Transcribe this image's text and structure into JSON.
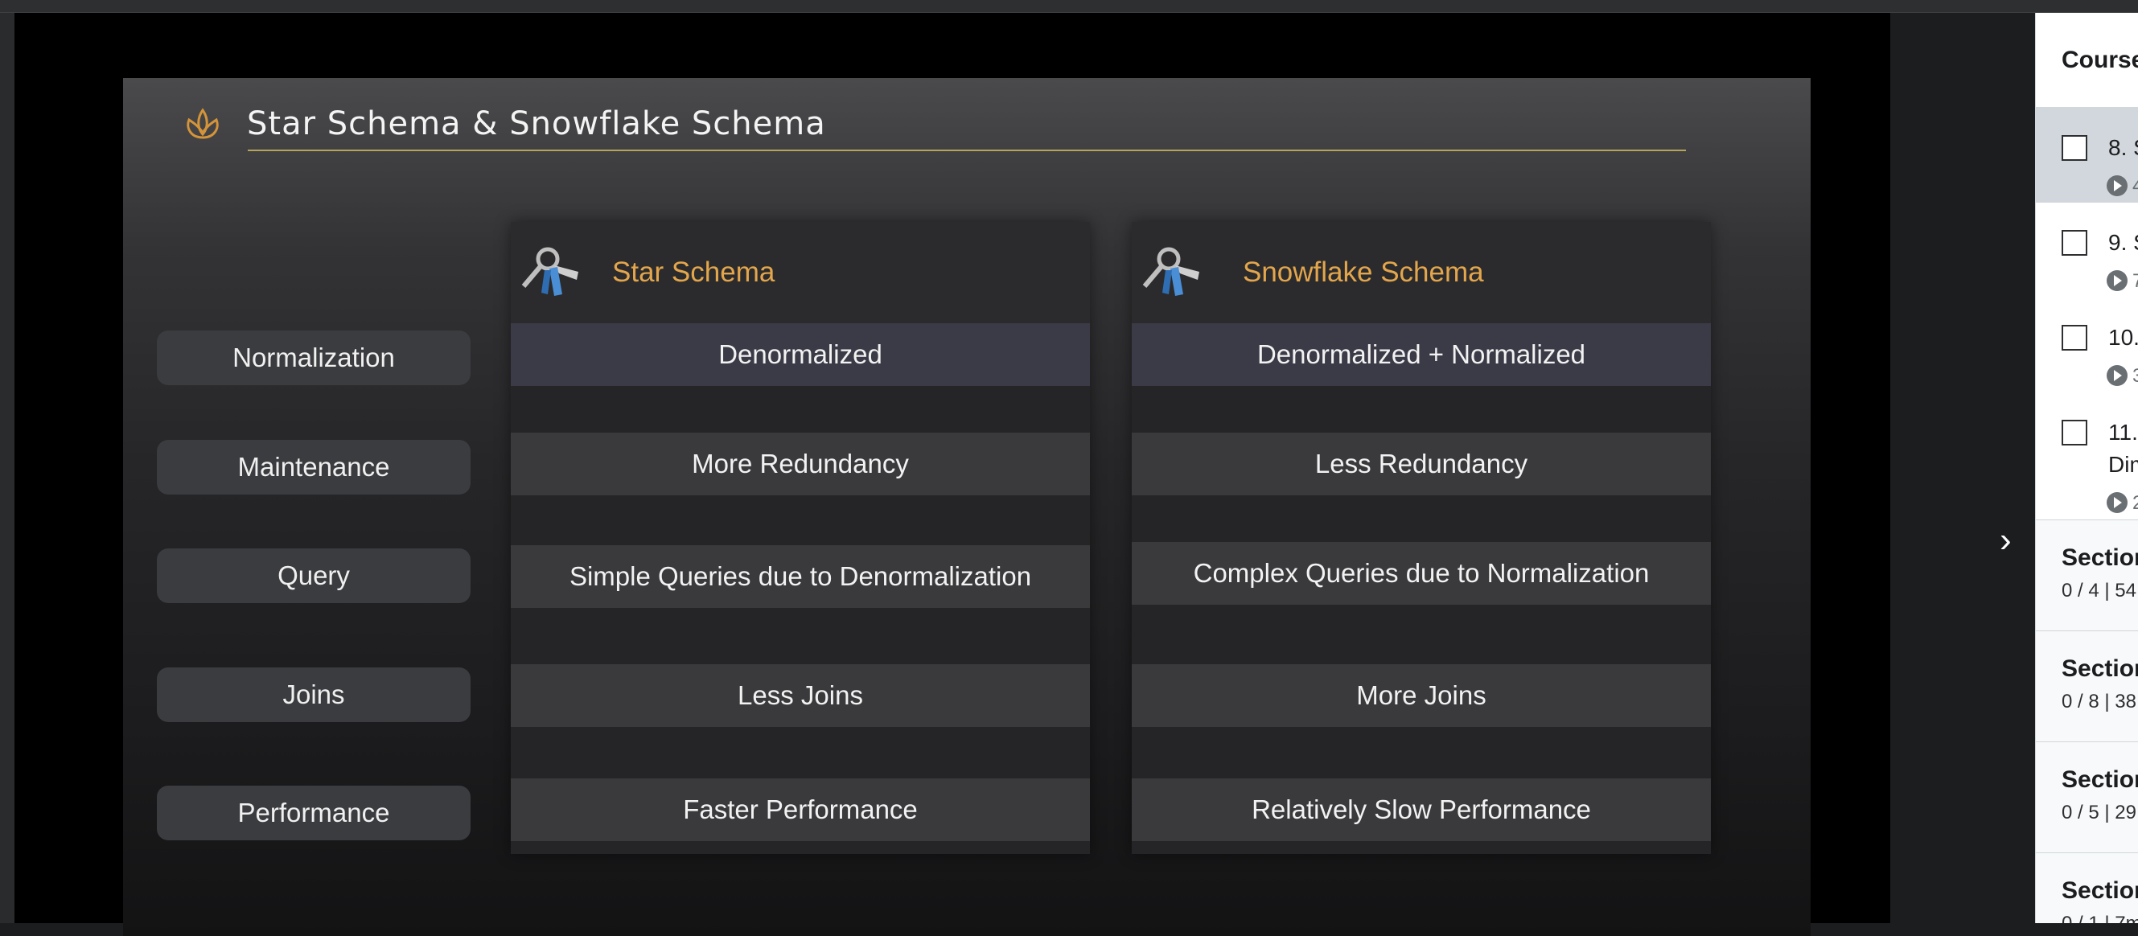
{
  "slide": {
    "title": "Star Schema & Snowflake Schema",
    "row_labels": [
      "Normalization",
      "Maintenance",
      "Query",
      "Joins",
      "Performance"
    ],
    "columns": [
      {
        "title": "Star Schema",
        "icon": "keys-icon",
        "cells": [
          "Denormalized",
          "More Redundancy",
          "Simple Queries due to Denormalization",
          "Less Joins",
          "Faster Performance"
        ]
      },
      {
        "title": "Snowflake Schema",
        "icon": "keys-icon",
        "cells": [
          "Denormalized + Normalized",
          "Less Redundancy",
          "Complex Queries due to Normalization",
          "More Joins",
          "Relatively Slow Performance"
        ]
      }
    ],
    "colors": {
      "accent": "#e3a64c",
      "rule": "#b5a55a"
    }
  },
  "sidebar": {
    "header": "Course",
    "lectures": [
      {
        "title": "8. S",
        "sub": "",
        "meta": "4",
        "active": true
      },
      {
        "title": "9. S",
        "sub": "",
        "meta": "7",
        "active": false
      },
      {
        "title": "10.",
        "sub": "",
        "meta": "3",
        "active": false
      },
      {
        "title": "11.",
        "sub": "Dim",
        "meta": "2",
        "active": false
      }
    ],
    "sections": [
      {
        "title": "Section",
        "meta": "0 / 4 | 54"
      },
      {
        "title": "Section",
        "meta": "0 / 8 | 38"
      },
      {
        "title": "Section",
        "meta": "0 / 5 | 29"
      },
      {
        "title": "Section",
        "meta": "0 / 1 | 7m"
      }
    ]
  },
  "player": {
    "next_icon": "chevron-right-icon"
  }
}
